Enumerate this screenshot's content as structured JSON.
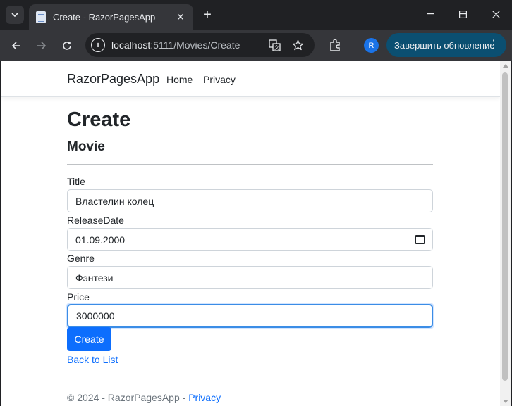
{
  "browser": {
    "tab_title": "Create - RazorPagesApp",
    "url_host": "localhost",
    "url_path": ":5111/Movies/Create",
    "profile_initial": "R",
    "update_label": "Завершить обновление",
    "accent_color": "#0b4f71"
  },
  "site": {
    "brand": "RazorPagesApp",
    "nav": [
      "Home",
      "Privacy"
    ]
  },
  "page": {
    "title": "Create",
    "subtitle": "Movie"
  },
  "form": {
    "fields": [
      {
        "label": "Title",
        "value": "Властелин колец",
        "type": "text"
      },
      {
        "label": "ReleaseDate",
        "value": "01.09.2000",
        "type": "date"
      },
      {
        "label": "Genre",
        "value": "Фэнтези",
        "type": "text"
      },
      {
        "label": "Price",
        "value": "3000000",
        "type": "text",
        "focused": true
      }
    ],
    "submit_label": "Create",
    "back_link": "Back to List",
    "primary_color": "#0d6efd"
  },
  "footer": {
    "text": "© 2024 - RazorPagesApp - ",
    "link": "Privacy"
  }
}
